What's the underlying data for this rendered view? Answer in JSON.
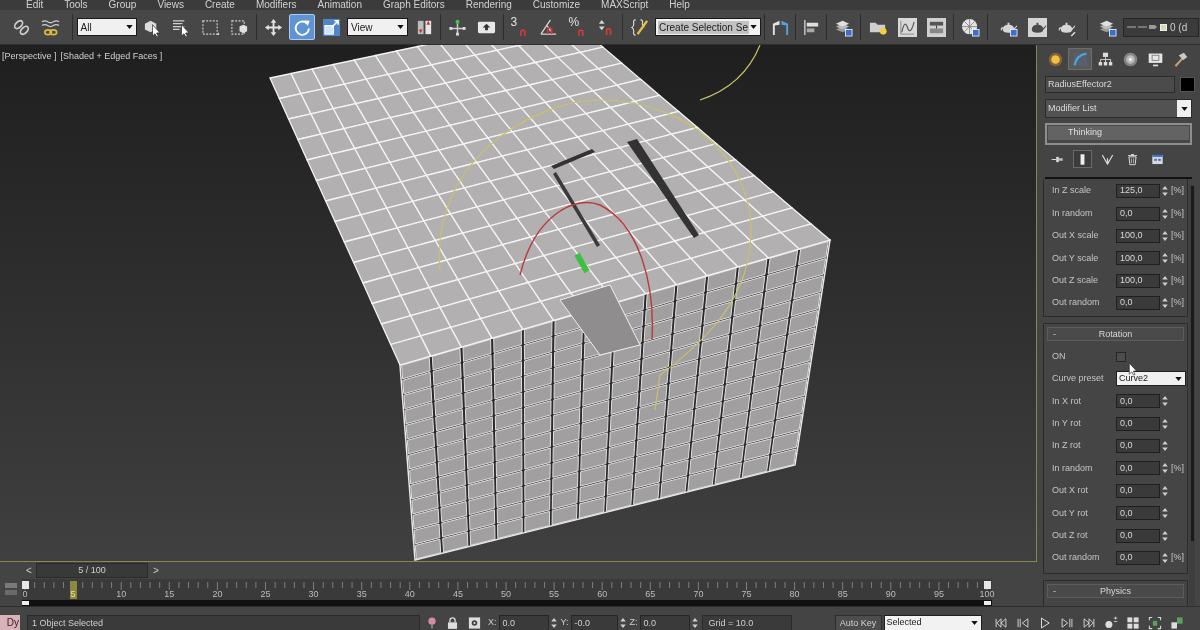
{
  "menu_bar": {
    "items": [
      "Edit",
      "Tools",
      "Group",
      "Views",
      "Create",
      "Modifiers",
      "Animation",
      "Graph Editors",
      "Rendering",
      "Customize",
      "MAXScript",
      "Help"
    ]
  },
  "toolbar": {
    "groups": [
      [
        {
          "kind": "link",
          "selected": false
        },
        {
          "kind": "bind",
          "selected": false
        }
      ],
      [
        {
          "kind": "selection-filter",
          "value": "All"
        },
        {
          "kind": "select-object",
          "selected": false
        },
        {
          "kind": "select-by-name",
          "selected": false
        },
        {
          "kind": "rect-region",
          "selected": false
        },
        {
          "kind": "window-crossing",
          "selected": false
        }
      ],
      [
        {
          "kind": "move",
          "selected": false
        },
        {
          "kind": "rotate",
          "selected": true
        },
        {
          "kind": "scale",
          "selected": false
        },
        {
          "kind": "reference-coordinate",
          "value": "View"
        },
        {
          "kind": "pivot",
          "selected": false
        }
      ],
      [
        {
          "kind": "manipulate",
          "selected": false
        },
        {
          "kind": "keyboard-override",
          "selected": false
        }
      ],
      [
        {
          "kind": "snap",
          "label": "3",
          "selected": false
        },
        {
          "kind": "angle-snap",
          "selected": false
        },
        {
          "kind": "snap",
          "label": "%",
          "selected": false
        },
        {
          "kind": "spinner-snap",
          "selected": false
        }
      ],
      [
        {
          "kind": "edit-named-sets",
          "selected": false
        },
        {
          "kind": "named-selection",
          "value": "Create Selection Se"
        }
      ],
      [
        {
          "kind": "mirror",
          "selected": false
        }
      ],
      [
        {
          "kind": "align",
          "selected": false
        }
      ],
      [
        {
          "kind": "layers",
          "selected": false
        }
      ],
      [
        {
          "kind": "scene-explorer",
          "selected": false
        },
        {
          "kind": "curve-editor",
          "selected": false
        },
        {
          "kind": "schematic",
          "selected": false
        }
      ],
      [
        {
          "kind": "material-editor",
          "selected": false
        }
      ],
      [
        {
          "kind": "render-setup",
          "selected": false
        },
        {
          "kind": "rendered-frame",
          "selected": false
        },
        {
          "kind": "render",
          "selected": false
        }
      ],
      [
        {
          "kind": "layers",
          "selected": false
        },
        {
          "kind": "layer-field",
          "value": "0 (d"
        }
      ]
    ]
  },
  "viewport": {
    "labels": [
      "[Perspective ]",
      "[Shaded + Edged Faces ]"
    ],
    "active": true
  },
  "command_panel": {
    "tabs": [
      {
        "kind": "create",
        "selected": false
      },
      {
        "kind": "modify",
        "selected": true
      },
      {
        "kind": "hierarchy",
        "selected": false
      },
      {
        "kind": "motion",
        "selected": false
      },
      {
        "kind": "display",
        "selected": false
      },
      {
        "kind": "utilities",
        "selected": false
      }
    ],
    "object_name": "RadiusEffector2",
    "modifier_list": "Modifier List",
    "stack": [
      {
        "label": "Thinking",
        "selected": true
      }
    ],
    "stack_tools": [
      {
        "kind": "pin",
        "on": false
      },
      {
        "kind": "show-end-result",
        "on": true
      },
      {
        "kind": "make-unique",
        "on": false
      },
      {
        "kind": "remove-modifier",
        "on": false
      },
      {
        "kind": "configure",
        "on": false
      }
    ],
    "rollouts": [
      {
        "rows": [
          {
            "kind": "spinner",
            "label": "In Z scale",
            "value": "125,0",
            "unit": "[%]"
          },
          {
            "kind": "spinner",
            "label": "In random",
            "value": "0,0",
            "unit": "[%]"
          },
          {
            "kind": "spinner",
            "label": "Out X scale",
            "value": "100,0",
            "unit": "[%]"
          },
          {
            "kind": "spinner",
            "label": "Out Y scale",
            "value": "100,0",
            "unit": "[%]"
          },
          {
            "kind": "spinner",
            "label": "Out Z scale",
            "value": "100,0",
            "unit": "[%]"
          },
          {
            "kind": "spinner",
            "label": "Out random",
            "value": "0,0",
            "unit": "[%]"
          }
        ]
      },
      {
        "toggle": "-",
        "title": "Rotation",
        "rows": [
          {
            "kind": "checkbox",
            "label": "ON",
            "checked": false
          },
          {
            "kind": "dropdown",
            "label": "Curve preset",
            "value": "Curve2"
          },
          {
            "kind": "spinner",
            "label": "In X rot",
            "value": "0,0"
          },
          {
            "kind": "spinner",
            "label": "In Y rot",
            "value": "0,0"
          },
          {
            "kind": "spinner",
            "label": "In Z rot",
            "value": "0,0"
          },
          {
            "kind": "spinner",
            "label": "In random",
            "value": "0,0",
            "unit": "[%]"
          },
          {
            "kind": "spinner",
            "label": "Out X rot",
            "value": "0,0"
          },
          {
            "kind": "spinner",
            "label": "Out Y rot",
            "value": "0,0"
          },
          {
            "kind": "spinner",
            "label": "Out Z rot",
            "value": "0,0"
          },
          {
            "kind": "spinner",
            "label": "Out random",
            "value": "0,0",
            "unit": "[%]"
          }
        ]
      },
      {
        "toggle": "-",
        "title": "Physics"
      }
    ]
  },
  "timeline": {
    "prev": "<",
    "label": "5 / 100",
    "next": ">",
    "level": 0.05,
    "frames": [
      "0",
      "5",
      "10",
      "15",
      "20",
      "25",
      "30",
      "35",
      "40",
      "45",
      "50",
      "55",
      "60",
      "65",
      "70",
      "75",
      "80",
      "85",
      "90",
      "95",
      "100"
    ]
  },
  "status_bar": {
    "listener": "Dy",
    "selection": "1 Object Selected",
    "coords": [
      {
        "axis": "X:",
        "value": "0.0"
      },
      {
        "axis": "Y:",
        "value": "-0.0"
      },
      {
        "axis": "Z:",
        "value": "0.0"
      }
    ],
    "grid": "Grid = 10.0",
    "auto_key": "Auto Key",
    "key_filter": "Selected",
    "playback": [
      {
        "kind": "go-start"
      },
      {
        "kind": "prev-frame"
      },
      {
        "kind": "play"
      },
      {
        "kind": "next-frame"
      },
      {
        "kind": "go-end"
      },
      {
        "kind": "key-mode"
      },
      {
        "kind": "time-config"
      },
      {
        "kind": "zoom-extents"
      },
      {
        "kind": "zoom-all"
      }
    ]
  }
}
